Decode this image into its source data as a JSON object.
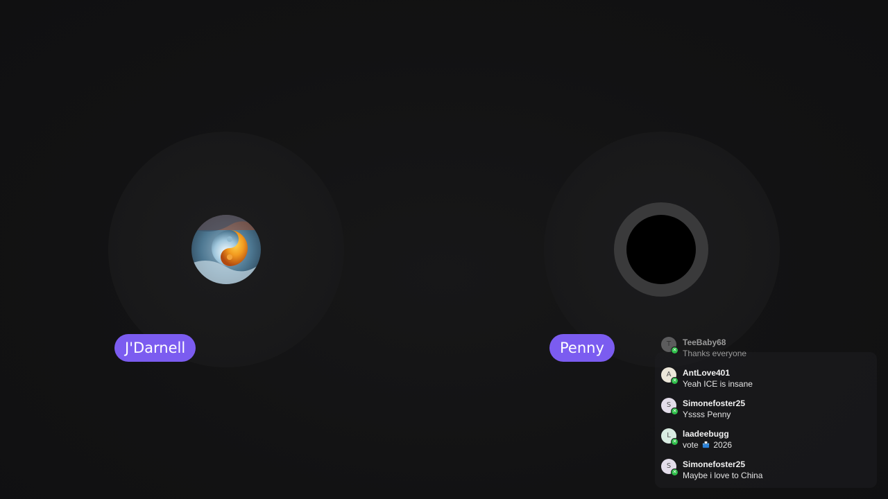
{
  "participants": [
    {
      "name": "J'Darnell",
      "avatar": "yin-yang-fire-ice-image"
    },
    {
      "name": "Penny",
      "avatar": "black-circle-speaking-ring"
    }
  ],
  "chat": {
    "messages": [
      {
        "user": "TeeBaby68",
        "initial": "T",
        "text": "Thanks everyone",
        "avatar_color": "#8a8a8a"
      },
      {
        "user": "AntLove401",
        "initial": "A",
        "text": "Yeah ICE is insane",
        "avatar_color": "#ece7da"
      },
      {
        "user": "Simonefoster25",
        "initial": "S",
        "text": "Yssss Penny",
        "avatar_color": "#e3ddea"
      },
      {
        "user": "laadeebugg",
        "initial": "L",
        "text_before": "vote",
        "text_after": "2026",
        "icon": "ballot-box-icon",
        "avatar_color": "#d9ece2"
      },
      {
        "user": "Simonefoster25",
        "initial": "S",
        "text": "Maybe i love to China",
        "avatar_color": "#e3ddea"
      }
    ]
  },
  "colors": {
    "accent": "#7b5cf0",
    "background": "#111112",
    "badge": "#2fbf4a"
  }
}
